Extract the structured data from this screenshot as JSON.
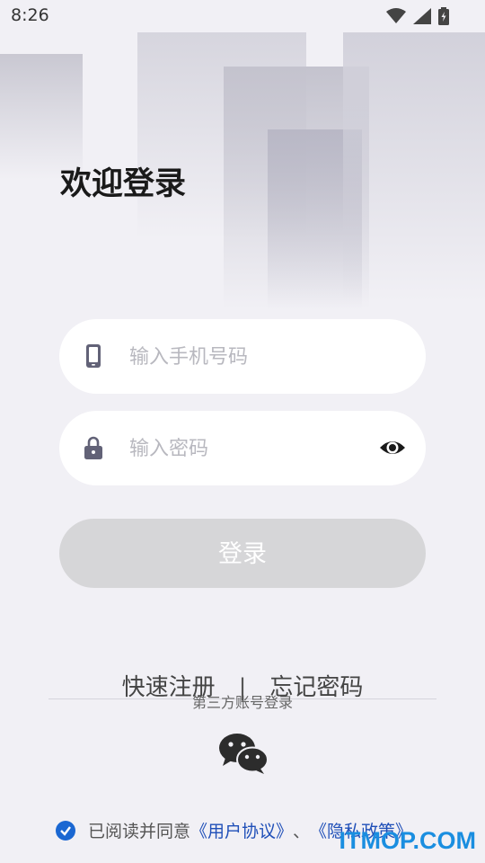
{
  "status_bar": {
    "time": "8:26"
  },
  "page": {
    "title": "欢迎登录"
  },
  "form": {
    "phone_placeholder": "输入手机号码",
    "phone_value": "",
    "password_placeholder": "输入密码",
    "password_value": "",
    "login_label": "登录"
  },
  "links": {
    "register": "快速注册",
    "separator": "|",
    "forgot": "忘记密码"
  },
  "third_party": {
    "label": "第三方账号登录",
    "icon": "wechat-icon"
  },
  "agreement": {
    "checked": true,
    "prefix": "已阅读并同意",
    "user_agreement": "《用户协议》",
    "joiner": "、",
    "privacy_policy": "《隐私政策》"
  },
  "watermark": "ITMOP.COM",
  "icons": [
    "phone-icon",
    "lock-icon",
    "eye-icon",
    "wifi-icon",
    "signal-icon",
    "battery-icon",
    "check-icon"
  ],
  "colors": {
    "accent": "#1a67d2",
    "button_disabled": "#d6d6d8",
    "background": "#f1f0f5"
  }
}
